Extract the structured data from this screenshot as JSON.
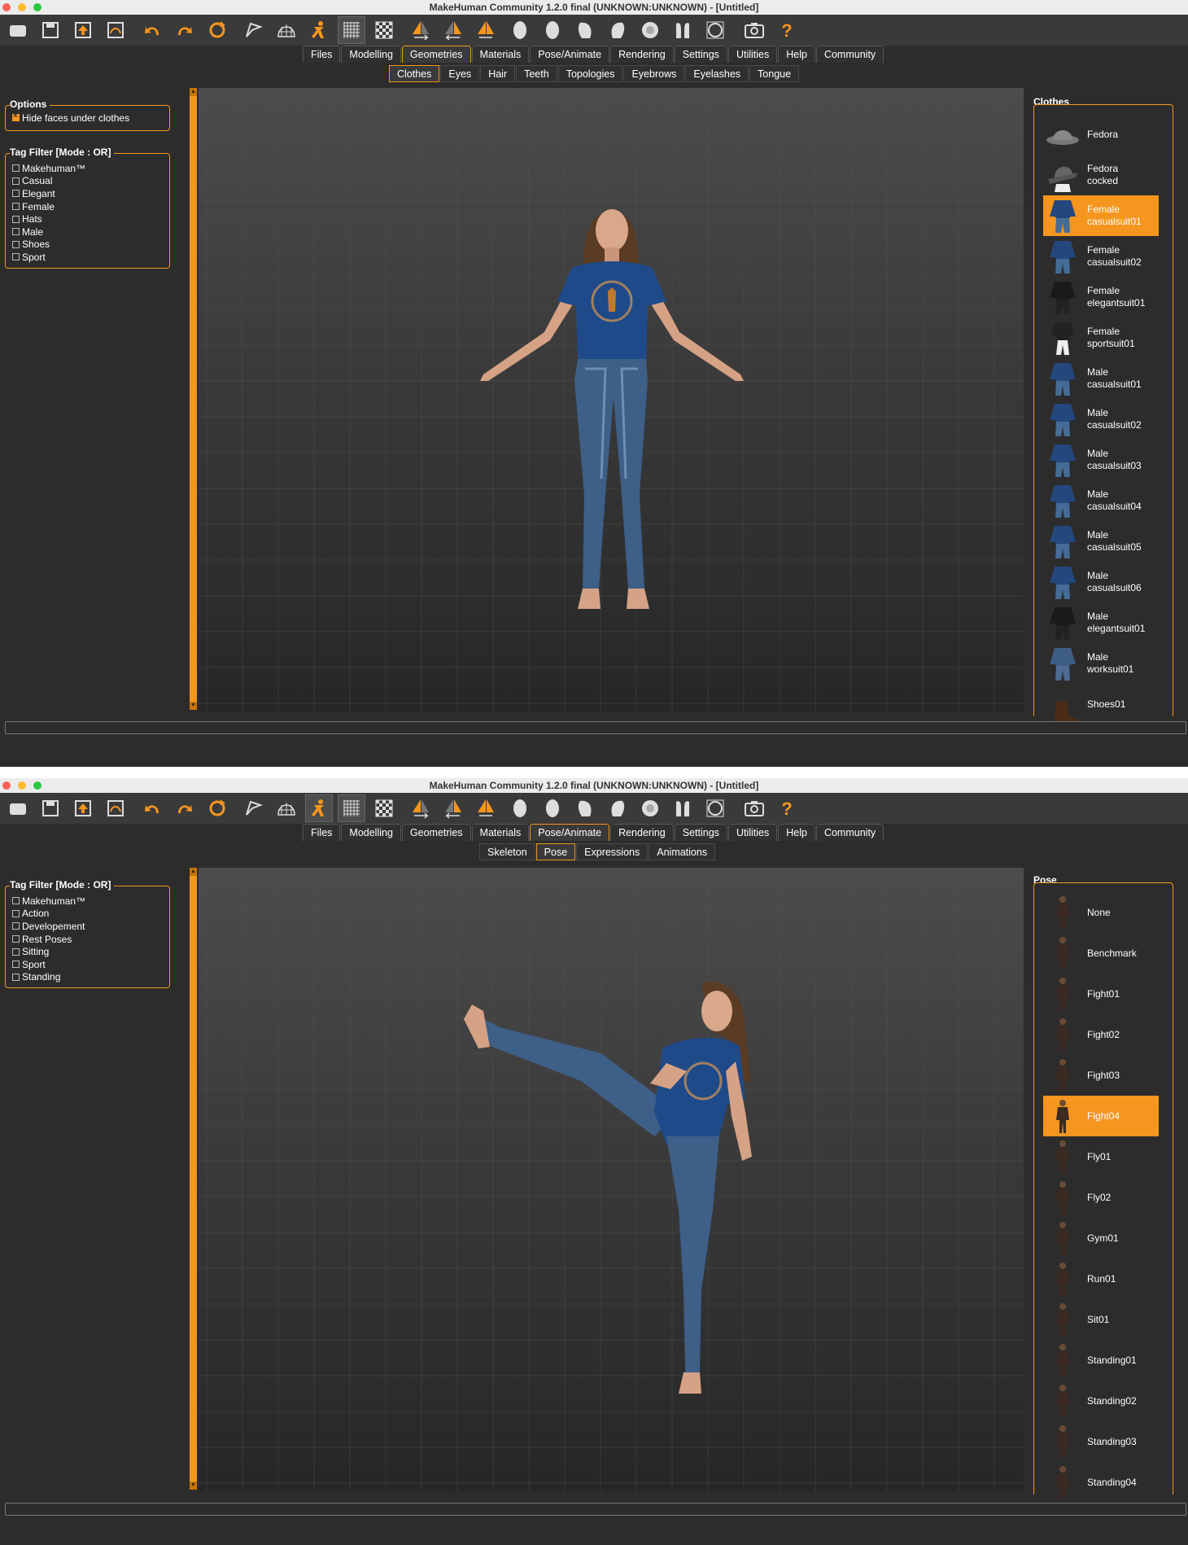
{
  "colors": {
    "accent": "#f5961e",
    "panel_bg": "#2c2c2c",
    "toolbar_bg": "#3a3a3a"
  },
  "windows": [
    {
      "title": "MakeHuman Community 1.2.0 final (UNKNOWN:UNKNOWN) - [Untitled]",
      "main_tabs": [
        "Files",
        "Modelling",
        "Geometries",
        "Materials",
        "Pose/Animate",
        "Rendering",
        "Settings",
        "Utilities",
        "Help",
        "Community"
      ],
      "active_main_tab": "Geometries",
      "sub_tabs": [
        "Clothes",
        "Eyes",
        "Hair",
        "Teeth",
        "Topologies",
        "Eyebrows",
        "Eyelashes",
        "Tongue"
      ],
      "active_sub_tab": "Clothes",
      "options": {
        "title": "Options",
        "items": [
          {
            "label": "Hide faces under clothes",
            "checked": true
          }
        ]
      },
      "tag_filter": {
        "title": "Tag Filter [Mode : OR]",
        "items": [
          "Makehuman™",
          "Casual",
          "Elegant",
          "Female",
          "Hats",
          "Male",
          "Shoes",
          "Sport"
        ]
      },
      "library": {
        "title": "Clothes",
        "items": [
          {
            "label": "Fedora",
            "icon": "fedora-hat-icon"
          },
          {
            "label": "Fedora\ncocked",
            "icon": "fedora-cocked-icon"
          },
          {
            "label": "Female\ncasualsuit01",
            "icon": "casualsuit-icon",
            "selected": true
          },
          {
            "label": "Female\ncasualsuit02",
            "icon": "casualsuit-icon"
          },
          {
            "label": "Female\nelegantsuit01",
            "icon": "elegantsuit-icon"
          },
          {
            "label": "Female\nsportsuit01",
            "icon": "sportsuit-icon"
          },
          {
            "label": "Male\ncasualsuit01",
            "icon": "casualsuit-icon"
          },
          {
            "label": "Male\ncasualsuit02",
            "icon": "casualsuit-icon"
          },
          {
            "label": "Male\ncasualsuit03",
            "icon": "casualsuit-icon"
          },
          {
            "label": "Male\ncasualsuit04",
            "icon": "casualsuit-icon"
          },
          {
            "label": "Male\ncasualsuit05",
            "icon": "casualsuit-icon"
          },
          {
            "label": "Male\ncasualsuit06",
            "icon": "casualsuit-icon"
          },
          {
            "label": "Male\nelegantsuit01",
            "icon": "elegantsuit-icon"
          },
          {
            "label": "Male\nworksuit01",
            "icon": "worksuit-icon"
          },
          {
            "label": "Shoes01",
            "icon": "shoes-icon"
          }
        ]
      }
    },
    {
      "title": "MakeHuman Community 1.2.0 final (UNKNOWN:UNKNOWN) - [Untitled]",
      "main_tabs": [
        "Files",
        "Modelling",
        "Geometries",
        "Materials",
        "Pose/Animate",
        "Rendering",
        "Settings",
        "Utilities",
        "Help",
        "Community"
      ],
      "active_main_tab": "Pose/Animate",
      "sub_tabs": [
        "Skeleton",
        "Pose",
        "Expressions",
        "Animations"
      ],
      "active_sub_tab": "Pose",
      "tag_filter": {
        "title": "Tag Filter [Mode : OR]",
        "items": [
          "Makehuman™",
          "Action",
          "Developement",
          "Rest Poses",
          "Sitting",
          "Sport",
          "Standing"
        ]
      },
      "library": {
        "title": "Pose",
        "items": [
          {
            "label": "None",
            "icon": "pose-figure-icon"
          },
          {
            "label": "Benchmark",
            "icon": "pose-figure-icon"
          },
          {
            "label": "Fight01",
            "icon": "pose-figure-icon"
          },
          {
            "label": "Fight02",
            "icon": "pose-figure-icon"
          },
          {
            "label": "Fight03",
            "icon": "pose-figure-icon"
          },
          {
            "label": "Fight04",
            "icon": "pose-figure-icon",
            "selected": true
          },
          {
            "label": "Fly01",
            "icon": "pose-figure-icon"
          },
          {
            "label": "Fly02",
            "icon": "pose-figure-icon"
          },
          {
            "label": "Gym01",
            "icon": "pose-figure-icon"
          },
          {
            "label": "Run01",
            "icon": "pose-figure-icon"
          },
          {
            "label": "Sit01",
            "icon": "pose-figure-icon"
          },
          {
            "label": "Standing01",
            "icon": "pose-figure-icon"
          },
          {
            "label": "Standing02",
            "icon": "pose-figure-icon"
          },
          {
            "label": "Standing03",
            "icon": "pose-figure-icon"
          },
          {
            "label": "Standing04",
            "icon": "pose-figure-icon"
          }
        ]
      }
    }
  ],
  "toolbar_tools": [
    {
      "name": "new-icon"
    },
    {
      "name": "save-icon"
    },
    {
      "name": "load-icon"
    },
    {
      "name": "export-icon"
    },
    {
      "name": "undo-icon"
    },
    {
      "name": "redo-icon"
    },
    {
      "name": "reset-icon"
    },
    {
      "name": "smooth-icon"
    },
    {
      "name": "wireframe-icon"
    },
    {
      "name": "pose-icon"
    },
    {
      "name": "grid-icon"
    },
    {
      "name": "background-icon"
    },
    {
      "name": "symmetry-right-icon"
    },
    {
      "name": "symmetry-left-icon"
    },
    {
      "name": "symmetry-icon"
    },
    {
      "name": "front-view-icon"
    },
    {
      "name": "back-view-icon"
    },
    {
      "name": "left-view-icon"
    },
    {
      "name": "right-view-icon"
    },
    {
      "name": "top-view-icon"
    },
    {
      "name": "bottom-view-icon"
    },
    {
      "name": "reset-camera-icon"
    },
    {
      "name": "screenshot-icon"
    },
    {
      "name": "help-icon"
    }
  ]
}
